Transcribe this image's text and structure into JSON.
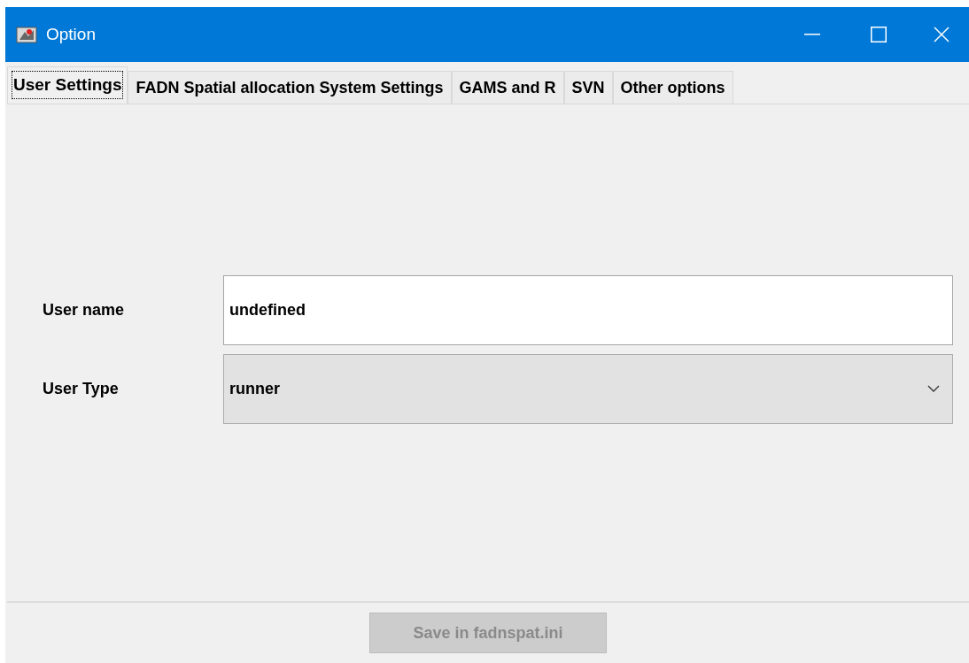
{
  "window": {
    "title": "Option"
  },
  "tabs": [
    {
      "label": "User Settings",
      "selected": true
    },
    {
      "label": "FADN Spatial allocation System Settings",
      "selected": false
    },
    {
      "label": "GAMS and R",
      "selected": false
    },
    {
      "label": "SVN",
      "selected": false
    },
    {
      "label": "Other options",
      "selected": false
    }
  ],
  "fields": [
    {
      "kind": "text",
      "label": "User name",
      "value": "undefined"
    },
    {
      "kind": "dropdown",
      "label": "User Type",
      "value": "runner"
    }
  ],
  "save_button": {
    "label": "Save in fadnspat.ini",
    "disabled": true
  }
}
